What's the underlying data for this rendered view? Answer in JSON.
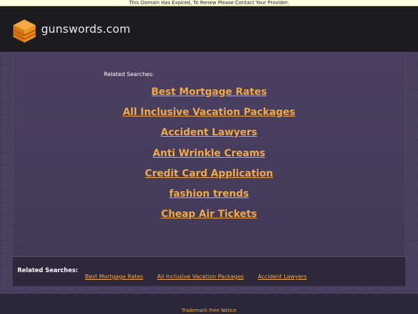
{
  "notice": {
    "text": "This Domain Has Expired, To Renew Please Contact Your Provider."
  },
  "header": {
    "domain": "gunswords.com"
  },
  "main": {
    "related_label": "Related Searches:",
    "links": [
      "Best Mortgage Rates",
      "All Inclusive Vacation Packages",
      "Accident Lawyers",
      "Anti Wrinkle Creams",
      "Credit Card Application",
      "fashion trends",
      "Cheap Air Tickets"
    ]
  },
  "bottom": {
    "label": "Related Searches:",
    "links": [
      "Best Mortgage Rates",
      "All Inclusive Vacation Packages",
      "Accident Lawyers"
    ]
  },
  "footer": {
    "link": "Trademark Free Notice"
  },
  "colors": {
    "accent": "#f0a944",
    "background": "#3d3352",
    "header": "#1d1d1f"
  },
  "icons": {
    "logo": "stacked-cube-logo-icon"
  }
}
